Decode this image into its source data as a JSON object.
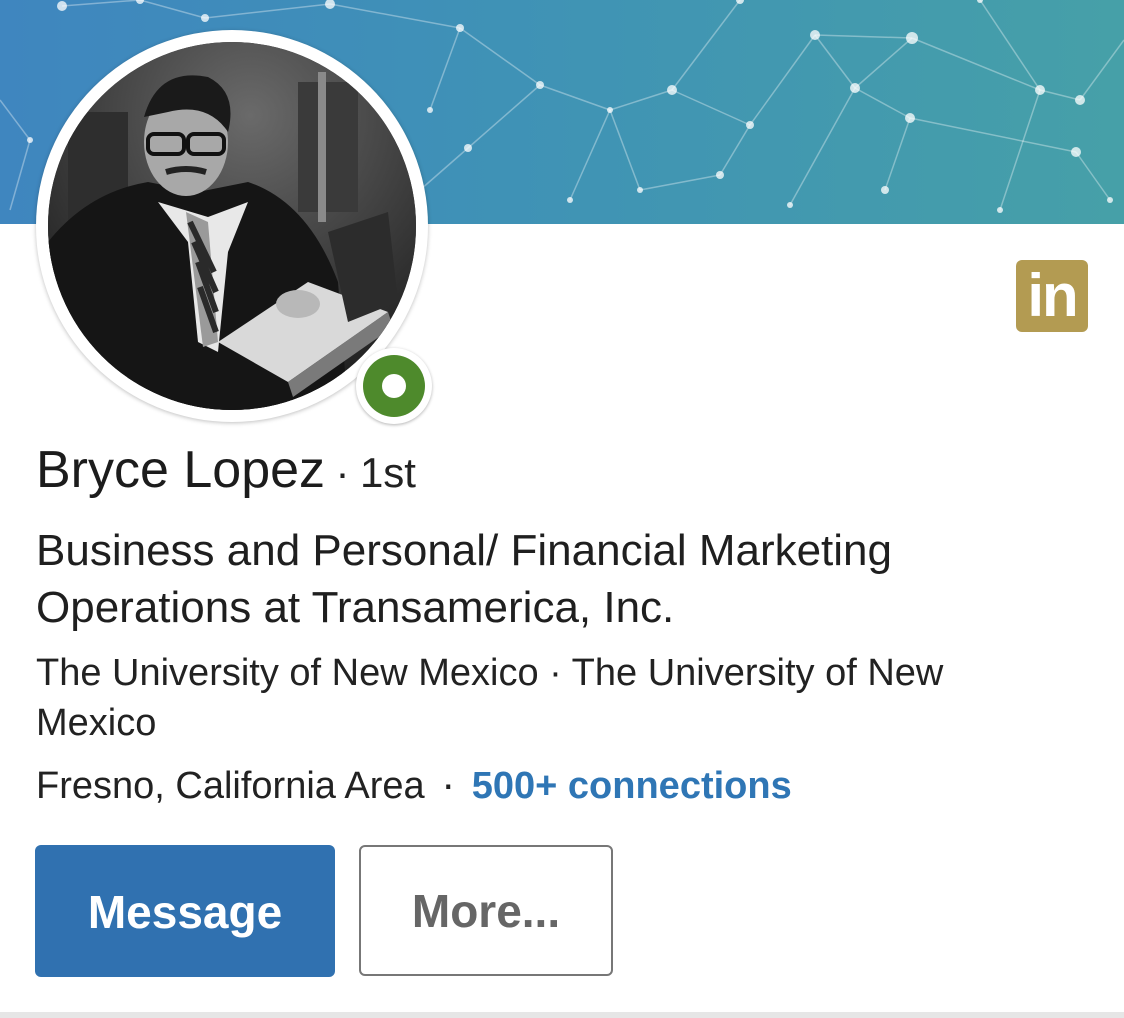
{
  "profile": {
    "name": "Bryce Lopez",
    "separator": "·",
    "degree": "1st",
    "headline": "Business and Personal/ Financial Marketing Operations at Transamerica, Inc.",
    "education": "The University of New Mexico · The University of New Mexico",
    "location": "Fresno, California Area",
    "connections": "500+ connections",
    "presence_status": "online"
  },
  "actions": {
    "message_label": "Message",
    "more_label": "More..."
  },
  "badge": {
    "icon": "linkedin-icon",
    "text": "in",
    "color": "#b39b52"
  },
  "colors": {
    "accent": "#3071b0",
    "link": "#2f76b5",
    "presence": "#4e8a2c"
  }
}
